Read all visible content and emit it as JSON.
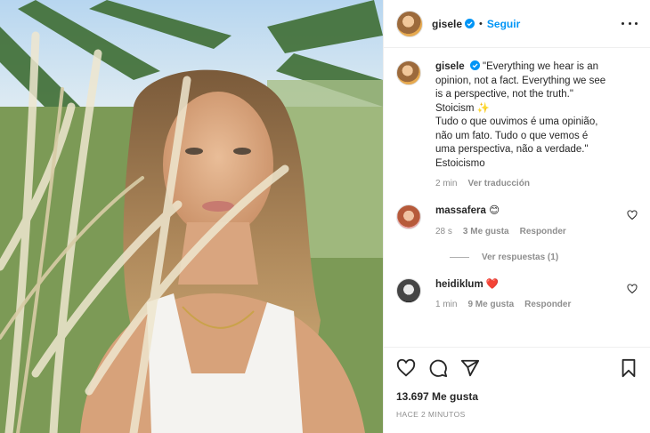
{
  "header": {
    "username": "gisele",
    "separator": "•",
    "follow_label": "Seguir"
  },
  "caption": {
    "username": "gisele",
    "lines": [
      "\"Everything we hear is an",
      "opinion, not a fact. Everything we see",
      "is a perspective, not the truth.\"",
      "Stoicism ✨",
      "Tudo o que ouvimos é uma opinião,",
      "não um fato. Tudo o que vemos é",
      "uma perspectiva, não a verdade.\"",
      "Estoicismo"
    ],
    "time": "2 min",
    "translate_label": "Ver traducción"
  },
  "comments": [
    {
      "username": "massafera",
      "text": "😊",
      "time": "28 s",
      "likes": "3 Me gusta",
      "reply_label": "Responder"
    },
    {
      "username": "heidiklum",
      "text": "❤️",
      "time": "1 min",
      "likes": "9 Me gusta",
      "reply_label": "Responder"
    }
  ],
  "view_replies_label": "Ver respuestas (1)",
  "likes_total": "13.697 Me gusta",
  "posted_ago": "HACE 2 MINUTOS",
  "icons": [
    "verified-icon",
    "more-options-icon",
    "heart-icon",
    "comment-icon",
    "share-icon",
    "bookmark-icon"
  ],
  "colors": {
    "accent": "#0095f6",
    "heart_red": "#ed4956",
    "text": "#262626",
    "muted": "#8e8e8e"
  }
}
